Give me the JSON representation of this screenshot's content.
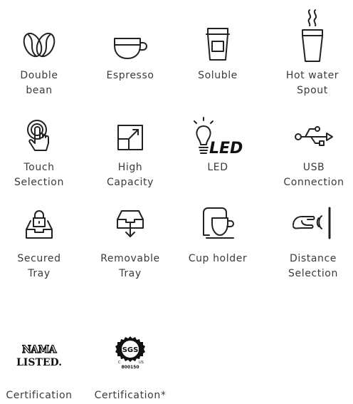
{
  "features": [
    {
      "label": "Double\nbean",
      "icon": "double-bean-icon"
    },
    {
      "label": "Espresso",
      "icon": "espresso-cup-icon"
    },
    {
      "label": "Soluble",
      "icon": "soluble-cup-icon"
    },
    {
      "label": "Hot water\nSpout",
      "icon": "hot-water-icon"
    },
    {
      "label": "Touch\nSelection",
      "icon": "touch-icon"
    },
    {
      "label": "High\nCapacity",
      "icon": "high-capacity-icon"
    },
    {
      "label": "LED",
      "icon": "led-bulb-icon",
      "icon_text": "LED"
    },
    {
      "label": "USB\nConnection",
      "icon": "usb-icon"
    },
    {
      "label": "Secured\nTray",
      "icon": "secured-tray-icon"
    },
    {
      "label": "Removable\nTray",
      "icon": "removable-tray-icon"
    },
    {
      "label": "Cup holder",
      "icon": "cup-holder-icon"
    },
    {
      "label": "Distance\nSelection",
      "icon": "distance-selection-icon"
    },
    {
      "label": "Certification",
      "icon": "nama-listed-logo",
      "logo_text": [
        "NAMA",
        "LISTED."
      ]
    },
    {
      "label": "Certification*",
      "icon": "sgs-logo",
      "logo_text": [
        "SGS",
        "C",
        "US",
        "800150"
      ]
    }
  ]
}
